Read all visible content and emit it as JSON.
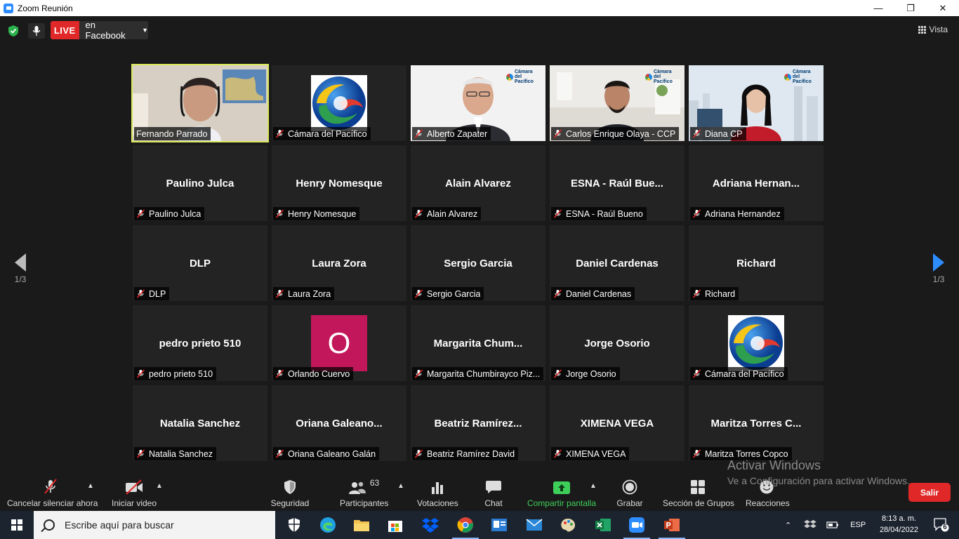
{
  "window": {
    "title": "Zoom Reunión",
    "minimize": "—",
    "restore": "❐",
    "close": "✕"
  },
  "topbar": {
    "live_badge": "LIVE",
    "live_target": "en Facebook",
    "view_label": "Vista"
  },
  "pager": {
    "left": "1/3",
    "right": "1/3"
  },
  "tiles": [
    {
      "big": "",
      "label": "Fernando Parrado",
      "muted": false,
      "kind": "video-fernando",
      "active": true
    },
    {
      "big": "",
      "label": "Cámara del Pacífico",
      "muted": true,
      "kind": "logo"
    },
    {
      "big": "",
      "label": "Alberto Zapater",
      "muted": true,
      "kind": "video-alberto"
    },
    {
      "big": "",
      "label": "Carlos Enrique Olaya - CCP",
      "muted": true,
      "kind": "video-carlos"
    },
    {
      "big": "",
      "label": "Diana CP",
      "muted": true,
      "kind": "video-diana"
    },
    {
      "big": "Paulino Julca",
      "label": "Paulino Julca",
      "muted": true
    },
    {
      "big": "Henry Nomesque",
      "label": "Henry Nomesque",
      "muted": true
    },
    {
      "big": "Alain Alvarez",
      "label": "Alain Alvarez",
      "muted": true
    },
    {
      "big": "ESNA - Raúl Bue...",
      "label": "ESNA - Raúl Bueno",
      "muted": true
    },
    {
      "big": "Adriana Hernan...",
      "label": "Adriana Hernandez",
      "muted": true
    },
    {
      "big": "DLP",
      "label": "DLP",
      "muted": true
    },
    {
      "big": "Laura Zora",
      "label": "Laura Zora",
      "muted": true
    },
    {
      "big": "Sergio Garcia",
      "label": "Sergio Garcia",
      "muted": true
    },
    {
      "big": "Daniel Cardenas",
      "label": "Daniel Cardenas",
      "muted": true
    },
    {
      "big": "Richard",
      "label": "Richard",
      "muted": true
    },
    {
      "big": "pedro prieto 510",
      "label": "pedro prieto 510",
      "muted": true
    },
    {
      "big": "",
      "label": "Orlando Cuervo",
      "muted": true,
      "kind": "avatar",
      "avatar_letter": "O"
    },
    {
      "big": "Margarita Chum...",
      "label": "Margarita Chumbirayco Piz...",
      "muted": true
    },
    {
      "big": "Jorge Osorio",
      "label": "Jorge Osorio",
      "muted": true
    },
    {
      "big": "",
      "label": "Cámara del Pacífico",
      "muted": true,
      "kind": "logo"
    },
    {
      "big": "Natalia Sanchez",
      "label": "Natalia Sanchez",
      "muted": true
    },
    {
      "big": "Oriana Galeano...",
      "label": "Oriana Galeano Galán",
      "muted": true
    },
    {
      "big": "Beatriz Ramírez...",
      "label": "Beatriz Ramírez David",
      "muted": true
    },
    {
      "big": "XIMENA VEGA",
      "label": "XIMENA VEGA",
      "muted": true
    },
    {
      "big": "Maritza Torres C...",
      "label": "Maritza Torres Copco",
      "muted": true
    }
  ],
  "camlogo_text": "Cámara del Pacífico",
  "toolbar": {
    "mute": "Cancelar silenciar ahora",
    "video": "Iniciar video",
    "security": "Seguridad",
    "participants": "Participantes",
    "participants_count": "63",
    "polls": "Votaciones",
    "chat": "Chat",
    "share": "Compartir pantalla",
    "record": "Grabar",
    "breakout": "Sección de Grupos",
    "reactions": "Reacciones",
    "leave": "Salir"
  },
  "watermark": {
    "line1": "Activar Windows",
    "line2": "Ve a Configuración para activar Windows."
  },
  "taskbar": {
    "search_placeholder": "Escribe aquí para buscar",
    "lang": "ESP",
    "time": "8:13 a. m.",
    "date": "28/04/2022",
    "notifications": "6"
  },
  "colors": {
    "accent_green": "#3ecf5a",
    "leave_red": "#e02828",
    "active_border": "#d9e85a",
    "avatar_pink": "#c2185b"
  }
}
